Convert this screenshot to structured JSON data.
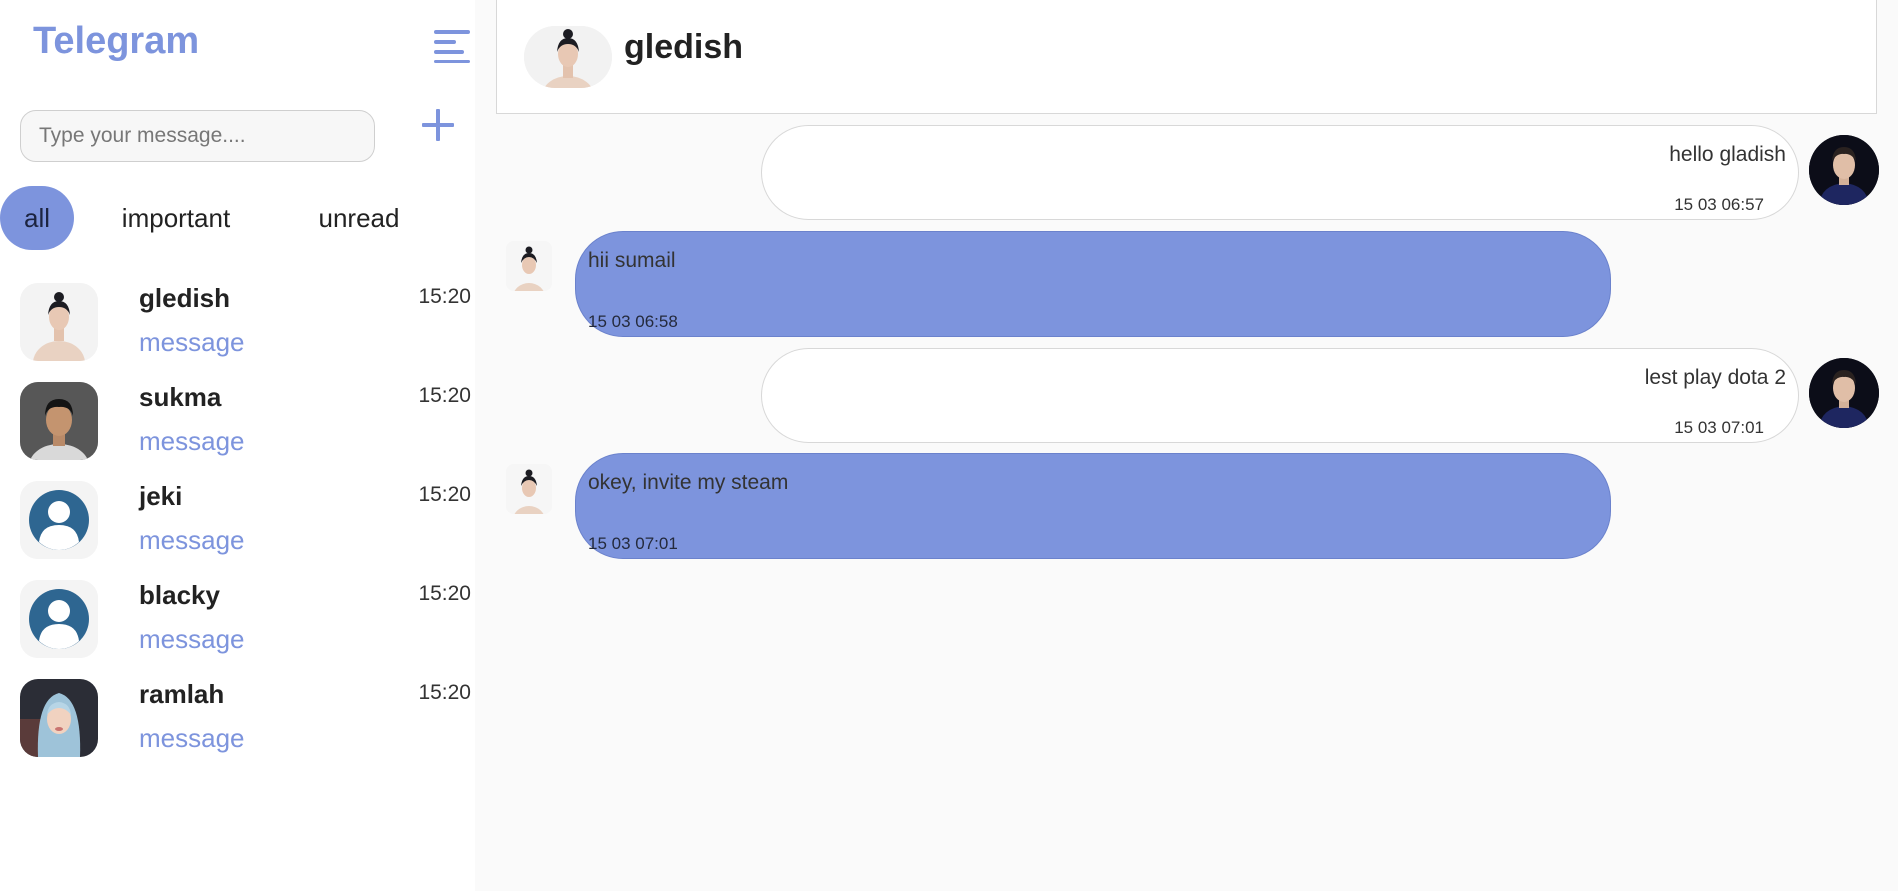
{
  "app": {
    "title": "Telegram"
  },
  "search": {
    "placeholder": "Type your message...."
  },
  "filters": [
    {
      "label": "all",
      "active": true
    },
    {
      "label": "important",
      "active": false
    },
    {
      "label": "unread",
      "active": false
    }
  ],
  "chats": [
    {
      "name": "gledish",
      "preview": "message",
      "time": "15:20",
      "avatar": "woman-portrait-avatar"
    },
    {
      "name": "sukma",
      "preview": "message",
      "time": "15:20",
      "avatar": "man-portrait-avatar"
    },
    {
      "name": "jeki",
      "preview": "message",
      "time": "15:20",
      "avatar": "default-user-avatar"
    },
    {
      "name": "blacky",
      "preview": "message",
      "time": "15:20",
      "avatar": "default-user-avatar"
    },
    {
      "name": "ramlah",
      "preview": "message",
      "time": "15:20",
      "avatar": "hijab-woman-avatar"
    }
  ],
  "conversation": {
    "title": "gledish",
    "messages": [
      {
        "direction": "out",
        "text": "hello gladish",
        "time": "15 03 06:57"
      },
      {
        "direction": "in",
        "text": "hii sumail",
        "time": "15 03 06:58"
      },
      {
        "direction": "out",
        "text": "lest play dota 2",
        "time": "15 03 07:01"
      },
      {
        "direction": "in",
        "text": "okey, invite my steam",
        "time": "15 03 07:01"
      }
    ]
  },
  "colors": {
    "accent": "#7d94dd",
    "sidebar_bg": "#ffffff",
    "chat_bg": "#fafafa",
    "outgoing_bubble": "#ffffff",
    "incoming_bubble": "#7d94dd"
  }
}
